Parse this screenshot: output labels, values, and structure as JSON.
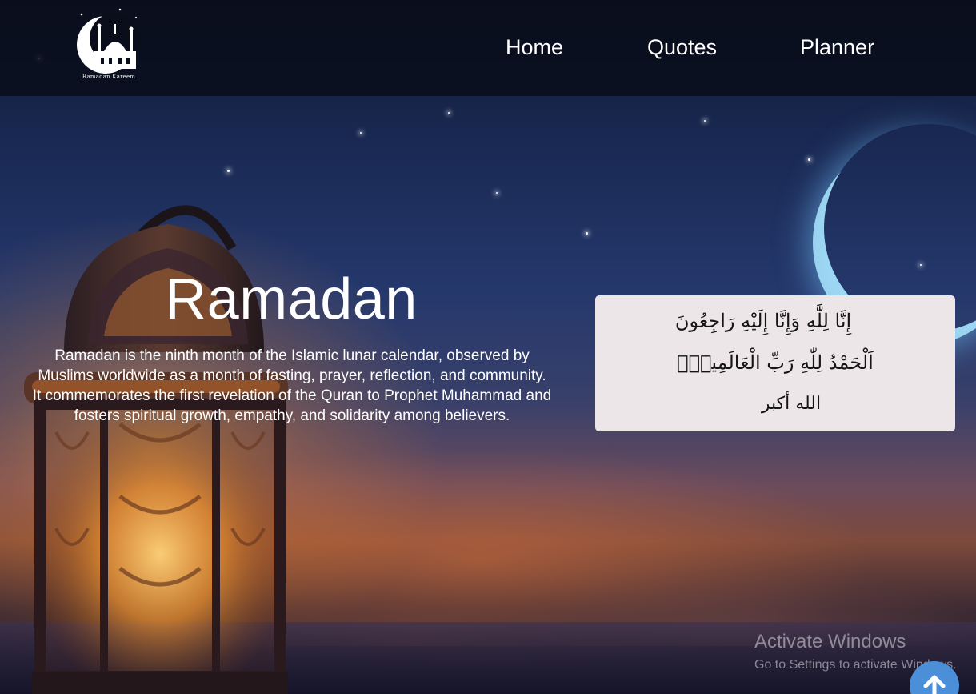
{
  "logo": {
    "icon": "mosque-crescent-icon",
    "caption": "Ramadan Kareem"
  },
  "nav": {
    "items": [
      {
        "label": "Home"
      },
      {
        "label": "Quotes"
      },
      {
        "label": "Planner"
      }
    ]
  },
  "hero": {
    "title": "Ramadan",
    "description": "Ramadan is the ninth month of the Islamic lunar calendar, observed by Muslims worldwide as a month of fasting, prayer, reflection, and community. It commemorates the first revelation of the Quran to Prophet Muhammad and fosters spiritual growth, empathy, and solidarity among believers."
  },
  "quote_card": {
    "lines": [
      "إِنَّا لِلَّٰهِ وَإِنَّا إِلَيْهِ رَاجِعُونَ",
      "اَلْحَمْدُ لِلّٰهِ رَبِّ الْعَالَمِينَۙ",
      "الله أكبر"
    ]
  },
  "watermark": {
    "title": "Activate Windows",
    "subtitle": "Go to Settings to activate Windows."
  },
  "scroll_top": {
    "icon": "arrow-up-icon",
    "color": "#4a8fd8"
  }
}
